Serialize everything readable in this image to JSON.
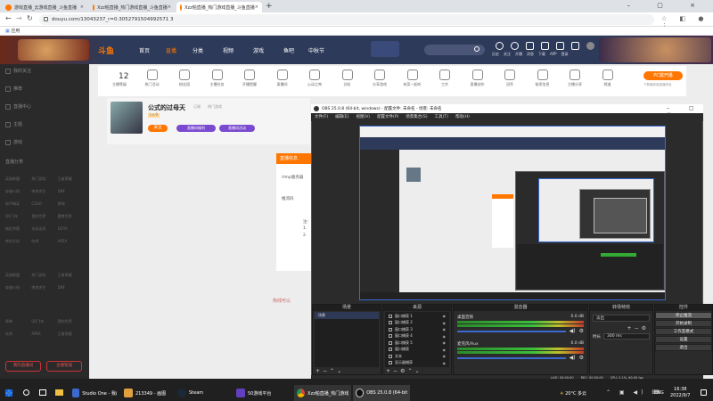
{
  "browser": {
    "tabs": [
      {
        "title": "游戏直播_云游戏直播_斗鱼直播",
        "active": false
      },
      {
        "title": "Xzz帕直播_热门游戏直播_斗鱼直播",
        "active": false
      },
      {
        "title": "Xzz帕直播_热门游戏直播_斗鱼直播",
        "active": true
      }
    ],
    "new_tab": "+",
    "back": "←",
    "forward": "→",
    "reload": "↻",
    "url": "douyu.com/13043237_r=0.3052791504992571 3",
    "bookmark": "应用"
  },
  "site": {
    "nav": [
      "首页",
      "直播",
      "分类",
      "视频",
      "游戏",
      "鱼吧",
      "中秋节"
    ],
    "search_placeholder": "",
    "header_icons": [
      "历史",
      "关注",
      "开播",
      "消息",
      "下载",
      "APP",
      "登录"
    ],
    "banner_text": "斗鱼",
    "categories": [
      {
        "n": "12",
        "l": "主播等级"
      },
      {
        "n": "",
        "l": "热门活动"
      },
      {
        "n": "",
        "l": "粉丝团"
      },
      {
        "n": "",
        "l": "主播任务"
      },
      {
        "n": "",
        "l": "开播提醒"
      },
      {
        "n": "",
        "l": "直播间"
      },
      {
        "n": "",
        "l": "心动之吻"
      },
      {
        "n": "",
        "l": "谷粒"
      },
      {
        "n": "",
        "l": "分享游戏"
      },
      {
        "n": "",
        "l": "有奖一起听"
      },
      {
        "n": "",
        "l": "工作"
      },
      {
        "n": "",
        "l": "直播创作"
      },
      {
        "n": "",
        "l": "冠军"
      },
      {
        "n": "",
        "l": "秘密信息"
      },
      {
        "n": "",
        "l": "主播分享"
      },
      {
        "n": "",
        "l": "频道"
      }
    ],
    "pc_button": "PC端开播",
    "pc_sub": "下载最新版直播伴侣",
    "streamer": {
      "name": "公式的过母天",
      "level": "Lv.9",
      "tag1": "订阅",
      "tag2": "热门游戏",
      "follow": "关注",
      "extra1": "直播间福利",
      "extra2": "直播间活动"
    },
    "sidebar": [
      "我的关注",
      "推荐",
      "直播中心",
      "主题",
      "游戏"
    ],
    "section_title": "直播分类",
    "grid1": [
      "英雄联盟",
      "热门游戏",
      "王者荣耀",
      "穿越火线",
      "绝地求生",
      "DNF",
      "和平精英",
      "CSGO",
      "原神",
      "QQ飞车",
      "我的世界",
      "魔兽世界",
      "暗区突围",
      "永劫无间",
      "DOTA",
      "单机主机",
      "吃鸡",
      "APEX"
    ],
    "grid2": [
      "英雄联盟",
      "热门游戏",
      "王者荣耀",
      "穿越火线",
      "绝地求生",
      "DNF"
    ],
    "grid3": [
      "原神",
      "QQ飞车",
      "我的世界",
      "吃鸡",
      "APEX",
      "王者荣耀"
    ],
    "bottom_btn1": "我的直播间",
    "bottom_btn2": "主播管理",
    "popup_title": "直播信息",
    "popup_lines": [
      "rtmp服务器",
      "推流码",
      "注:",
      "1.",
      "2."
    ],
    "stream_hint": "热线可以"
  },
  "obs": {
    "title": "OBS 25.0.8 (64-bit, windows) - 配置文件: 未命名 - 场景: 未命名",
    "menu": [
      "文件(F)",
      "编辑(E)",
      "视图(V)",
      "配置文件(P)",
      "场景集合(S)",
      "工具(T)",
      "帮助(H)"
    ],
    "docks": {
      "scenes": "场景",
      "sources": "来源",
      "mixer": "混音器",
      "transitions": "转场特效",
      "controls": "控件"
    },
    "scene_items": [
      "场景"
    ],
    "source_items": [
      "窗口捕获 1",
      "窗口捕获 2",
      "窗口捕获 3",
      "窗口捕获 4",
      "窗口捕获 5",
      "窗口捕获",
      "文本",
      "显示器捕获"
    ],
    "mixer": [
      {
        "name": "桌面音频",
        "db": "0.0 dB"
      },
      {
        "name": "麦克风/Aux",
        "db": "0.0 dB"
      }
    ],
    "transition": "淡出",
    "duration_label": "时长",
    "duration": "300 ms",
    "controls": [
      "停止推流",
      "开始录制",
      "工作室模式",
      "设置",
      "退出"
    ],
    "status": {
      "live": "LIVE: 00:00:00",
      "rec": "REC: 00:00:00",
      "cpu": "CPU: 2.1%, 60.00 fps"
    }
  },
  "taskbar": {
    "search": "",
    "apps": [
      "Studio One - 我的...",
      "213349 - 画图",
      "Steam",
      "50游戏平台",
      "Xzz帕直播_热门游戏...",
      "OBS 25.0.8 (64-bit..."
    ],
    "weather": "20°C 多云",
    "lang": "ENG",
    "time": "16:38",
    "date": "2022/9/7"
  },
  "colors": {
    "brand": "#ff7700",
    "obs_bg": "#2b2b2b",
    "nav_bg": "#2d3a5a",
    "taskbar": "#202020"
  }
}
